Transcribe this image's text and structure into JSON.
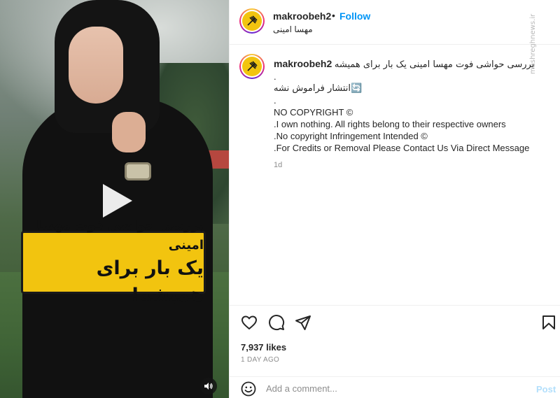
{
  "media": {
    "caption_line1": "بررسی حواشی فوت مهسا امینی",
    "caption_line2": "یک بار برای همیشه!",
    "play_icon": "play-icon",
    "mute_icon": "speaker-icon"
  },
  "header": {
    "username": "makroobeh2",
    "separator": "•",
    "follow_label": "Follow",
    "subtitle": "مهسا امینی",
    "watermark": "mashreghnews.ir"
  },
  "post": {
    "username": "makroobeh2",
    "title_text": "بررسی حواشی فوت مهسا امینی یک بار برای همیشه",
    "line_dot1": ".",
    "line_share": "انتشار فراموش نشه🔄",
    "line_dot2": ".",
    "line_copyright": "NO COPYRIGHT ©",
    "line_own": ".I own nothing. All rights belong to their respective owners",
    "line_infringe": ".No copyright Infringement Intended ©",
    "line_credits": ".For Credits or Removal Please Contact Us Via Direct Message",
    "time": "1d"
  },
  "actions": {
    "like_icon": "heart-icon",
    "comment_icon": "comment-icon",
    "share_icon": "paper-plane-icon",
    "save_icon": "bookmark-icon",
    "likes": "7,937 likes",
    "date": "1 DAY AGO"
  },
  "comment_bar": {
    "emoji_icon": "smiley-icon",
    "placeholder": "Add a comment...",
    "post_label": "Post"
  },
  "colors": {
    "accent": "#0095f6",
    "post_disabled": "#b2dffc",
    "banner": "#f2c40f",
    "text": "#262626",
    "muted": "#8e8e8e"
  }
}
